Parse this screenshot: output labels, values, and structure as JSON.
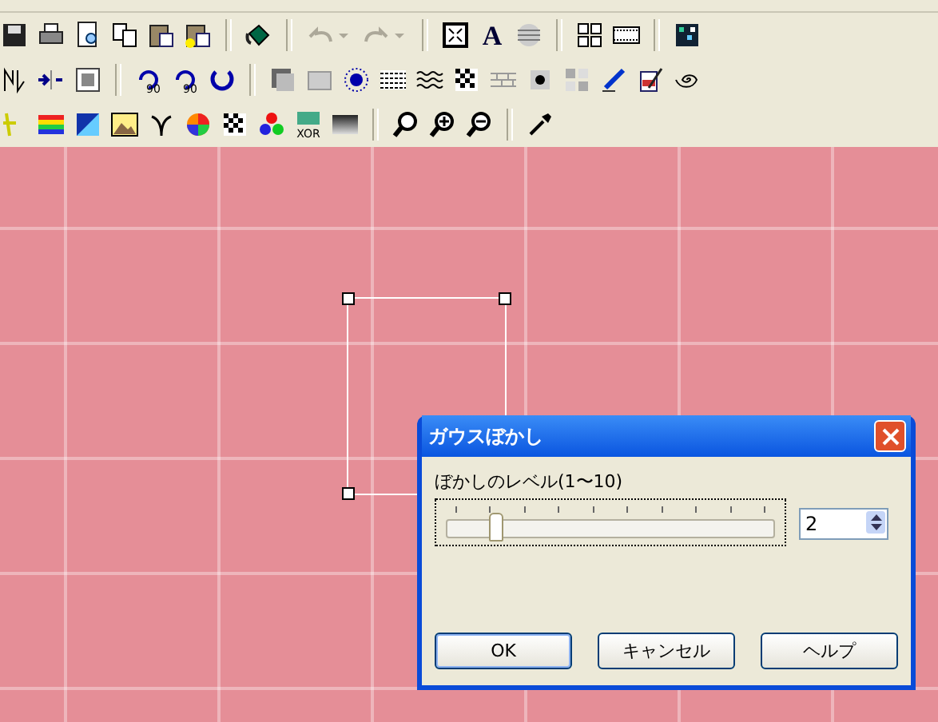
{
  "toolbar": {
    "font_button": "A",
    "rotate_left_label": "90",
    "rotate_right_label": "90",
    "xor_label": "XOR",
    "undo": {
      "disabled": true
    },
    "redo": {
      "disabled": true
    }
  },
  "dialog": {
    "title": "ガウスぼかし",
    "slider_label": "ぼかしのレベル(1〜10)",
    "slider": {
      "level": 0.11
    },
    "value": "2",
    "buttons": [
      "OK",
      "キャンセル",
      "ヘルプ"
    ]
  }
}
